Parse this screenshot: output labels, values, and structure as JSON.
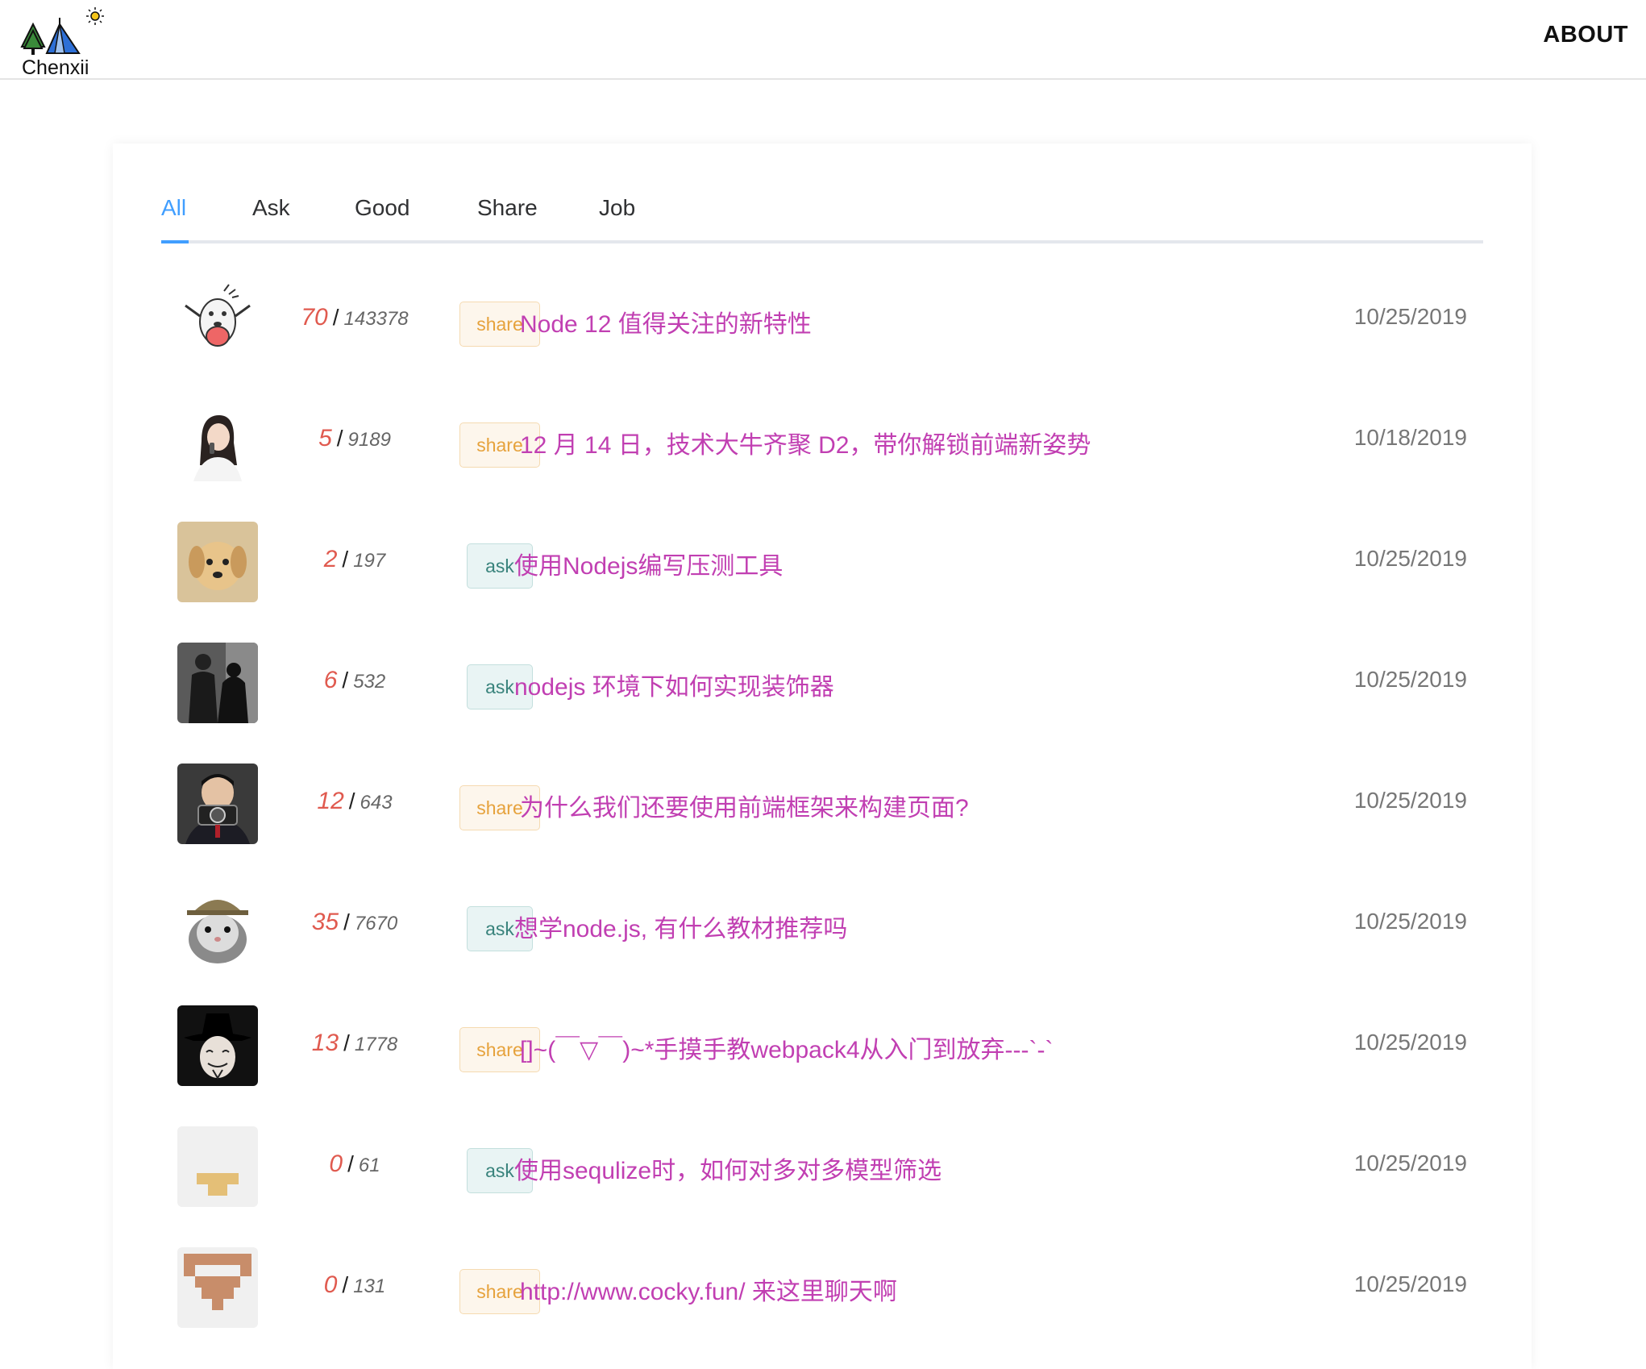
{
  "header": {
    "logo_text": "Chenxii",
    "about_label": "ABOUT"
  },
  "tabs": [
    {
      "label": "All",
      "active": true
    },
    {
      "label": "Ask",
      "active": false
    },
    {
      "label": "Good",
      "active": false
    },
    {
      "label": "Share",
      "active": false
    },
    {
      "label": "Job",
      "active": false
    }
  ],
  "topics": [
    {
      "avatar": "cartoon-character-avatar",
      "replies": "70",
      "sep": "/",
      "views": "143378",
      "tag": "share",
      "title": "Node 12 值得关注的新特性",
      "date": "10/25/2019"
    },
    {
      "avatar": "woman-phone-avatar",
      "replies": "5",
      "sep": "/",
      "views": "9189",
      "tag": "share",
      "title": "12 月 14 日，技术大牛齐聚 D2，带你解锁前端新姿势",
      "date": "10/18/2019"
    },
    {
      "avatar": "puppy-avatar",
      "replies": "2",
      "sep": "/",
      "views": "197",
      "tag": "ask",
      "title": "使用Nodejs编写压测工具",
      "date": "10/25/2019"
    },
    {
      "avatar": "dark-photo-avatar",
      "replies": "6",
      "sep": "/",
      "views": "532",
      "tag": "ask",
      "title": "nodejs 环境下如何实现装饰器",
      "date": "10/25/2019"
    },
    {
      "avatar": "man-camera-avatar",
      "replies": "12",
      "sep": "/",
      "views": "643",
      "tag": "share",
      "title": "为什么我们还要使用前端框架来构建页面?",
      "date": "10/25/2019"
    },
    {
      "avatar": "hamster-hat-avatar",
      "replies": "35",
      "sep": "/",
      "views": "7670",
      "tag": "ask",
      "title": "想学node.js, 有什么教材推荐吗",
      "date": "10/25/2019"
    },
    {
      "avatar": "mask-avatar",
      "replies": "13",
      "sep": "/",
      "views": "1778",
      "tag": "share",
      "title": "[]~(￣▽￣)~*手摸手教webpack4从入门到放弃---`-`",
      "date": "10/25/2019"
    },
    {
      "avatar": "identicon-yellow-avatar",
      "replies": "0",
      "sep": "/",
      "views": "61",
      "tag": "ask",
      "title": "使用sequlize时，如何对多对多模型筛选",
      "date": "10/25/2019"
    },
    {
      "avatar": "identicon-brown-avatar",
      "replies": "0",
      "sep": "/",
      "views": "131",
      "tag": "share",
      "title": "http://www.cocky.fun/ 来这里聊天啊",
      "date": "10/25/2019"
    }
  ],
  "colors": {
    "tab_active": "#409eff",
    "title": "#c13fb2",
    "reply_count": "#e05a4f",
    "share_tag": "#e6a23c",
    "ask_tag": "#39837c"
  }
}
